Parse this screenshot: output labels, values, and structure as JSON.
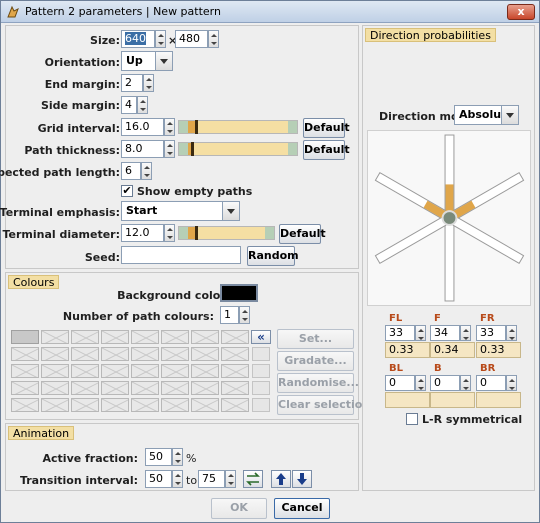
{
  "window": {
    "title": "Pattern 2 parameters | New pattern",
    "close_label": "x"
  },
  "main": {
    "size_label": "Size:",
    "size_width": "640",
    "size_x": "×",
    "size_height": "480",
    "orientation_label": "Orientation:",
    "orientation_value": "Up",
    "end_margin_label": "End margin:",
    "end_margin_value": "2",
    "side_margin_label": "Side margin:",
    "side_margin_value": "4",
    "grid_interval_label": "Grid interval:",
    "grid_interval_value": "16.0",
    "path_thickness_label": "Path thickness:",
    "path_thickness_value": "8.0",
    "expected_length_label": "Expected path length:",
    "expected_length_value": "6",
    "show_empty_label": "Show empty paths",
    "terminal_emphasis_label": "Terminal emphasis:",
    "terminal_emphasis_value": "Start",
    "terminal_diameter_label": "Terminal diameter:",
    "terminal_diameter_value": "12.0",
    "seed_label": "Seed:",
    "seed_value": "",
    "default_label": "Default",
    "random_label": "Random"
  },
  "colours": {
    "title": "Colours",
    "background_label": "Background colour:",
    "background_color": "#000000",
    "num_paths_label": "Number of path colours:",
    "num_paths_value": "1",
    "set_label": "Set...",
    "gradate_label": "Gradate...",
    "randomise_label": "Randomise...",
    "clear_label": "Clear selection",
    "shift_label": "«"
  },
  "animation": {
    "title": "Animation",
    "active_fraction_label": "Active fraction:",
    "active_fraction_value": "50",
    "percent": "%",
    "transition_label": "Transition interval:",
    "transition_from": "50",
    "to_label": "to",
    "transition_to": "75"
  },
  "direction": {
    "title": "Direction probabilities",
    "mode_label": "Direction mode:",
    "mode_value": "Absolute",
    "fl_label": "FL",
    "fl_value": "33",
    "fl_prob": "0.33",
    "f_label": "F",
    "f_value": "34",
    "f_prob": "0.34",
    "fr_label": "FR",
    "fr_value": "33",
    "fr_prob": "0.33",
    "bl_label": "BL",
    "bl_value": "0",
    "bl_prob": "",
    "b_label": "B",
    "b_value": "0",
    "b_prob": "",
    "br_label": "BR",
    "br_value": "0",
    "br_prob": "",
    "symmetric_label": "L-R symmetrical"
  },
  "footer": {
    "ok_label": "OK",
    "cancel_label": "Cancel"
  },
  "colors": {
    "accent": "#e0a64a",
    "slider_track": "#f5dfa3",
    "panel_title_bg": "#f3dfa4"
  }
}
